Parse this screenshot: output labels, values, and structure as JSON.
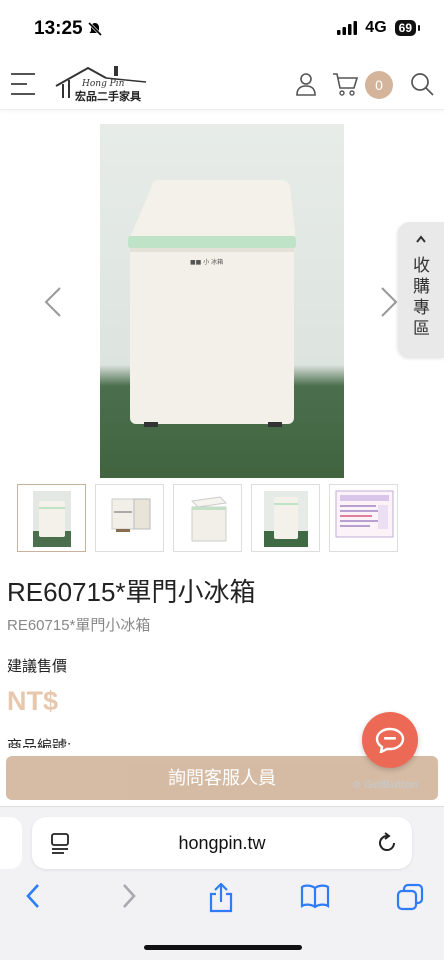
{
  "status": {
    "time": "13:25",
    "network": "4G",
    "battery": "69"
  },
  "header": {
    "logo_text": "宏品二手家具",
    "logo_sub": "Hong Pin",
    "cart_count": "0"
  },
  "gallery": {
    "favorites_label": "收購專區",
    "thumbnail_count": 5
  },
  "product": {
    "title": "RE60715*單門小冰箱",
    "subtitle": "RE60715*單門小冰箱",
    "price_label": "建議售價",
    "price": "NT$",
    "code_label": "商品編號:"
  },
  "actions": {
    "contact_button": "詢問客服人員",
    "getbutton": "GetButton"
  },
  "browser": {
    "url": "hongpin.tw"
  },
  "colors": {
    "accent": "#d4b8a0",
    "price": "#e8c8ad",
    "chat": "#ec6a55",
    "link": "#2f7cf6"
  }
}
